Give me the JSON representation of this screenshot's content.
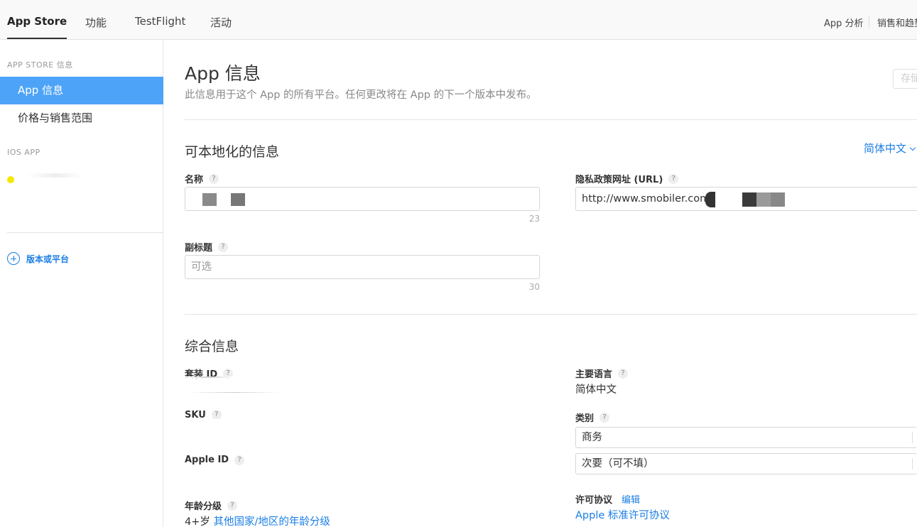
{
  "topnav": {
    "tabs": [
      "App Store",
      "功能",
      "TestFlight",
      "活动"
    ],
    "right": [
      "App 分析",
      "销售和趋势"
    ]
  },
  "sidebar": {
    "section1": "APP STORE 信息",
    "items": [
      "App 信息",
      "价格与销售范围"
    ],
    "section2": "IOS APP",
    "add_version": "版本或平台"
  },
  "header": {
    "title": "App 信息",
    "subtitle": "此信息用于这个 App 的所有平台。任何更改将在 App 的下一个版本中发布。",
    "save": "存储"
  },
  "localizable": {
    "title": "可本地化的信息",
    "language": "简体中文",
    "name_label": "名称",
    "name_counter": "23",
    "subtitle_label": "副标题",
    "subtitle_placeholder": "可选",
    "subtitle_counter": "30",
    "privacy_label": "隐私政策网址 (URL)",
    "privacy_value": "http://www.smobiler.com"
  },
  "general": {
    "title": "综合信息",
    "bundle_label": "套装 ID",
    "sku_label": "SKU",
    "apple_id_label": "Apple ID",
    "age_label": "年龄分级",
    "age_value": "4+岁",
    "age_link": "其他国家/地区的年龄分级",
    "primary_lang_label": "主要语言",
    "primary_lang_value": "简体中文",
    "category_label": "类别",
    "category_primary": "商务",
    "category_secondary": "次要（可不填）",
    "license_label": "许可协议",
    "license_edit": "编辑",
    "license_value": "Apple 标准许可协议"
  },
  "colors": {
    "accent": "#1a7ee6",
    "sidebar_active": "#4da3f7"
  },
  "help_glyph": "?"
}
